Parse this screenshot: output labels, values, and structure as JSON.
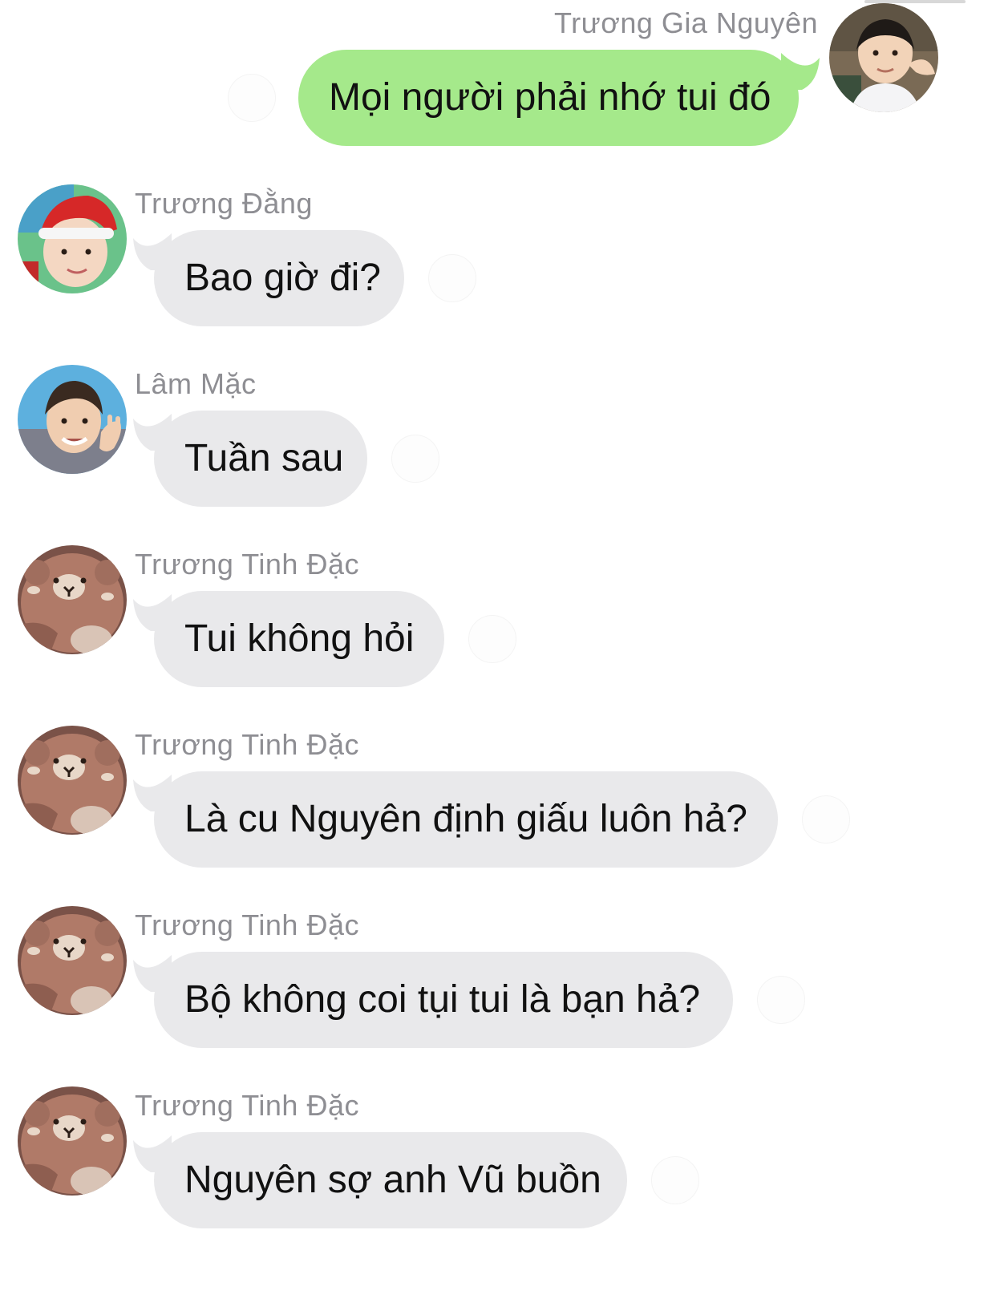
{
  "colors": {
    "incoming_bubble": "#e9e9eb",
    "outgoing_bubble": "#a5e98b",
    "sender_name": "#8e8e93",
    "message_text": "#111111"
  },
  "messages": [
    {
      "sender": "Trương Gia Nguyên",
      "text": "Mọi người phải nhớ tui đó",
      "direction": "outgoing",
      "avatar": "boy-portrait-avatar"
    },
    {
      "sender": "Trương Đằng",
      "text": "Bao giờ đi?",
      "direction": "incoming",
      "avatar": "santa-hat-boy-avatar"
    },
    {
      "sender": "Lâm Mặc",
      "text": "Tuần sau",
      "direction": "incoming",
      "avatar": "waving-boy-avatar"
    },
    {
      "sender": "Trương Tinh Đặc",
      "text": "Tui không hỏi",
      "direction": "incoming",
      "avatar": "bear-hood-avatar"
    },
    {
      "sender": "Trương Tinh Đặc",
      "text": "Là cu Nguyên định giấu luôn hả?",
      "direction": "incoming",
      "avatar": "bear-hood-avatar"
    },
    {
      "sender": "Trương Tinh Đặc",
      "text": "Bộ không coi tụi tui là bạn hả?",
      "direction": "incoming",
      "avatar": "bear-hood-avatar"
    },
    {
      "sender": "Trương Tinh Đặc",
      "text": "Nguyên sợ anh Vũ buồn",
      "direction": "incoming",
      "avatar": "bear-hood-avatar"
    }
  ]
}
